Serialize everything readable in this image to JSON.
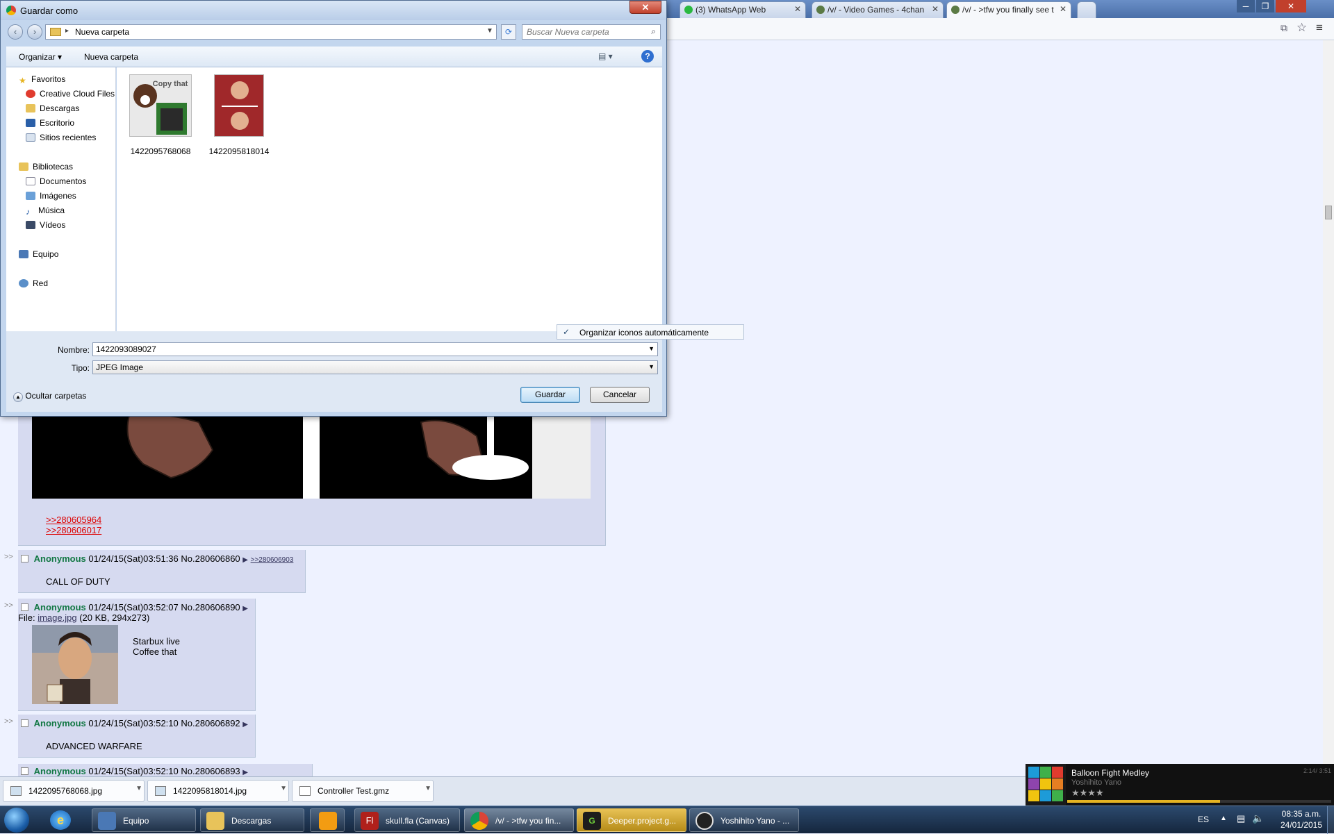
{
  "chrome": {
    "tabs": [
      {
        "label": "(3) WhatsApp Web",
        "color": "#2ab940"
      },
      {
        "label": "/v/ - Video Games - 4chan",
        "color": "#5b7a45"
      },
      {
        "label": "/v/ - >tfw you finally see t",
        "color": "#5b7a45",
        "active": true
      }
    ]
  },
  "dialog": {
    "title": "Guardar como",
    "breadcrumb": "Nueva carpeta",
    "search_placeholder": "Buscar Nueva carpeta",
    "cmd_organize": "Organizar",
    "cmd_new_folder": "Nueva carpeta",
    "nav": {
      "favorites": "Favoritos",
      "fav_items": [
        "Creative Cloud Files",
        "Descargas",
        "Escritorio",
        "Sitios recientes"
      ],
      "libraries": "Bibliotecas",
      "lib_items": [
        "Documentos",
        "Imágenes",
        "Música",
        "Vídeos"
      ],
      "computer": "Equipo",
      "network": "Red"
    },
    "files": [
      {
        "name": "1422095768068",
        "caption": "Copy that"
      },
      {
        "name": "1422095818014"
      }
    ],
    "context_menu_item": "Organizar iconos automáticamente",
    "name_label": "Nombre:",
    "name_value": "1422093089027",
    "type_label": "Tipo:",
    "type_value": "JPEG Image",
    "hide_folders": "Ocultar carpetas",
    "save_button": "Guardar",
    "cancel_button": "Cancelar"
  },
  "thread": {
    "op_quotes": [
      ">>280605964",
      ">>280606017"
    ],
    "posts": [
      {
        "name": "Anonymous",
        "info": "01/24/15(Sat)03:51:36 No.280606860",
        "reply": ">>280606903",
        "text": "CALL OF DUTY"
      },
      {
        "name": "Anonymous",
        "info": "01/24/15(Sat)03:52:07 No.280606890",
        "file_label": "File:",
        "file_link": "image.jpg",
        "file_meta": "(20 KB, 294x273)",
        "text_lines": [
          "Starbux live",
          "Coffee that"
        ]
      },
      {
        "name": "Anonymous",
        "info": "01/24/15(Sat)03:52:10 No.280606892",
        "text": "ADVANCED WARFARE"
      },
      {
        "name": "Anonymous",
        "info": "01/24/15(Sat)03:52:10 No.280606893"
      }
    ],
    "side_marker": ">>"
  },
  "downloads": [
    "1422095768068.jpg",
    "1422095818014.jpg",
    "Controller Test.gmz"
  ],
  "taskbar": {
    "items": [
      {
        "label": "Equipo"
      },
      {
        "label": "Descargas"
      },
      {
        "label": ""
      },
      {
        "label": "skull.fla (Canvas)"
      },
      {
        "label": "/v/ - >tfw you fin..."
      },
      {
        "label": "Deeper.project.g..."
      },
      {
        "label": "Yoshihito Yano - ..."
      }
    ],
    "lang": "ES",
    "time": "08:35 a.m.",
    "date": "24/01/2015"
  },
  "media": {
    "title": "Balloon Fight Medley",
    "artist": "Yoshihito Yano",
    "time": "2:14/ 3:51",
    "stars": "★★★★"
  }
}
